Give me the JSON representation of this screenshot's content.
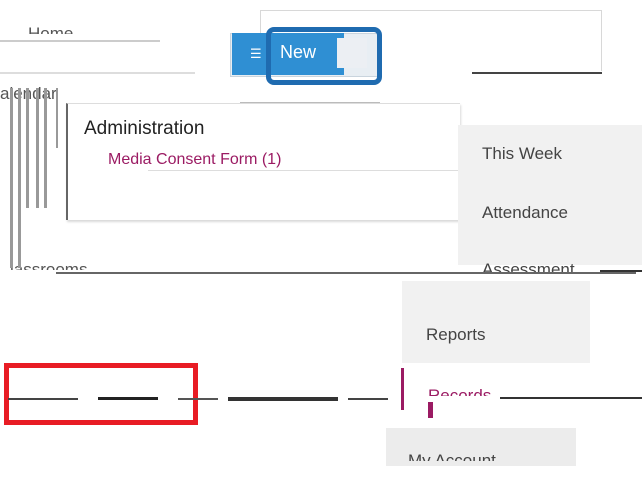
{
  "nav": {
    "home": "Home",
    "calendar": "alendar",
    "classrooms": "lassrooms"
  },
  "toolbar": {
    "new_label": "New",
    "new_icon": "compose-icon"
  },
  "admin": {
    "title": "Administration",
    "link": "Media Consent Form (1)"
  },
  "menu": {
    "this_week": "This Week",
    "attendance": "Attendance",
    "assessment": "Assessment",
    "reports": "Reports",
    "records": "Records",
    "my_account": "My Account"
  },
  "colors": {
    "accent_blue": "#2f8fd3",
    "highlight_blue": "#1f6bb0",
    "highlight_red": "#e81c24",
    "link_magenta": "#9b1b63",
    "menu_grey": "#f1f1f1"
  }
}
